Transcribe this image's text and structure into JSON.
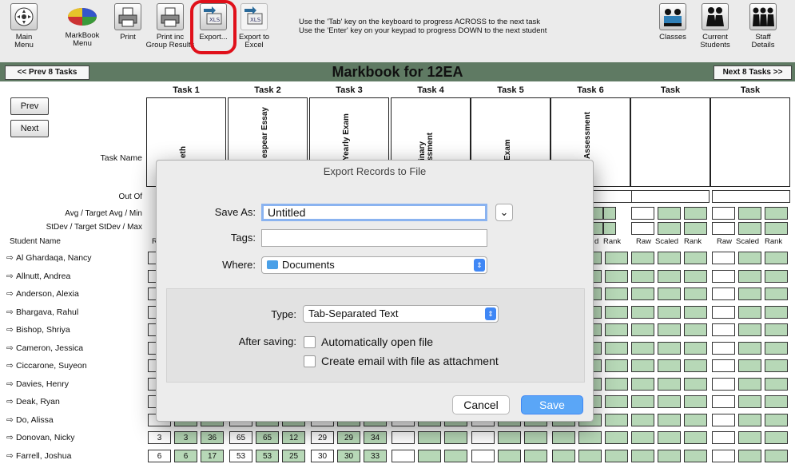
{
  "toolbar": {
    "buttons": [
      {
        "label": "Main\nMenu",
        "icon": "main-menu-icon"
      },
      {
        "label": "MarkBook\nMenu",
        "icon": "pie-chart-icon"
      },
      {
        "label": "Print",
        "icon": "printer-icon"
      },
      {
        "label": "Print inc\nGroup Results",
        "icon": "printer-group-icon"
      },
      {
        "label": "Export...",
        "icon": "xls-export-icon"
      },
      {
        "label": "Export to\nExcel",
        "icon": "xls-excel-icon"
      },
      {
        "label": "Classes",
        "icon": "classes-icon"
      },
      {
        "label": "Current\nStudents",
        "icon": "current-students-icon"
      },
      {
        "label": "Staff\nDetails",
        "icon": "staff-icon"
      }
    ],
    "tip_line1": "Use the 'Tab' key on the keyboard to progress ACROSS to the next task",
    "tip_line2": "Use the 'Enter' key on your keypad to progress DOWN to the next student"
  },
  "header": {
    "title": "Markbook for 12EA",
    "prev_tasks": "<< Prev 8 Tasks",
    "next_tasks": "Next 8 Tasks >>"
  },
  "side": {
    "prev": "Prev",
    "next": "Next",
    "task_name": "Task Name",
    "out_of": "Out Of",
    "avg": "Avg / Target Avg / Min",
    "stdev": "StDev / Target StDev / Max",
    "student_name": "Student Name"
  },
  "tasks": [
    {
      "header": "Task 1",
      "name": "eth"
    },
    {
      "header": "Task 2",
      "name": "espear Essay"
    },
    {
      "header": "Task 3",
      "name": "Yearly Exam"
    },
    {
      "header": "Task 4",
      "name": "inary\nssment"
    },
    {
      "header": "Task 5",
      "name": "Exam"
    },
    {
      "header": "Task 6",
      "name": "Assessment"
    },
    {
      "header": "Task",
      "name": ""
    },
    {
      "header": "Task",
      "name": ""
    }
  ],
  "col_headers": [
    "Raw",
    "Scaled",
    "Rank"
  ],
  "col_header_partial": [
    "R",
    "d",
    "Rank"
  ],
  "students": [
    "Al Ghardaqa, Nancy",
    "Allnutt, Andrea",
    "Anderson, Alexia",
    "Bhargava, Rahul",
    "Bishop, Shriya",
    "Cameron, Jessica",
    "Ciccarone, Suyeon",
    "Davies, Henry",
    "Deak, Ryan",
    "Do, Alissa",
    "Donovan, Nicky",
    "Farrell, Joshua"
  ],
  "marks_donovan": [
    "3",
    "3",
    "36",
    "65",
    "65",
    "12",
    "29",
    "29",
    "34"
  ],
  "marks_farrell": [
    "6",
    "6",
    "17",
    "53",
    "53",
    "25",
    "30",
    "30",
    "33"
  ],
  "dialog": {
    "title": "Export Records to File",
    "save_as_label": "Save As:",
    "save_as_value": "Untitled",
    "tags_label": "Tags:",
    "tags_value": "",
    "where_label": "Where:",
    "where_value": "Documents",
    "type_label": "Type:",
    "type_value": "Tab-Separated Text",
    "after_saving_label": "After saving:",
    "opt_open": "Automatically open file",
    "opt_email": "Create email with file as attachment",
    "cancel": "Cancel",
    "save": "Save"
  },
  "colors": {
    "accent": "#3f87f5",
    "highlight": "#e0101a",
    "titlebar": "#5f7a63",
    "cell_green": "#b7d8b7"
  }
}
